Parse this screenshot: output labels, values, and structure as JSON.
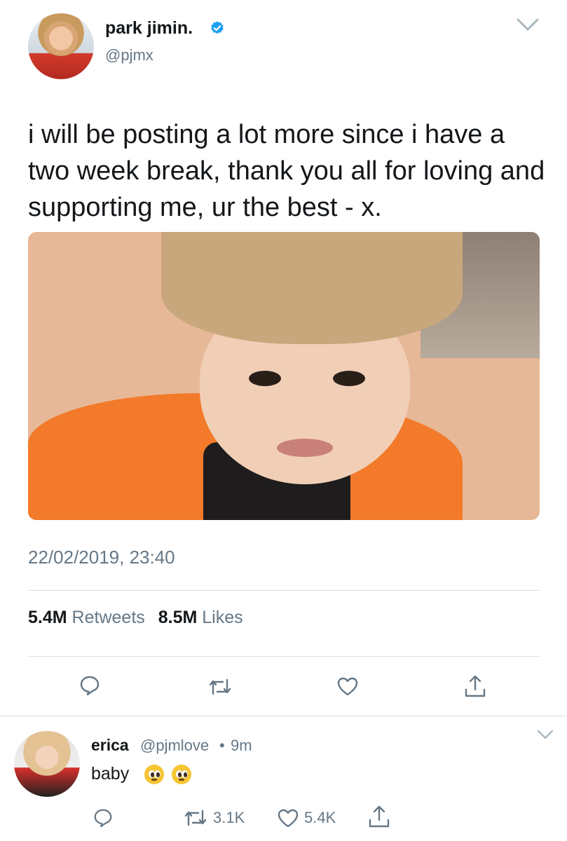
{
  "tweet": {
    "name": "park jimin.",
    "handle": "@pjmx",
    "text": "i will be posting a lot more since i have a two week break, thank you all for loving and supporting me, ur the best - x.",
    "timestamp": "22/02/2019, 23:40",
    "retweets_count": "5.4M",
    "retweets_label": "Retweets",
    "likes_count": "8.5M",
    "likes_label": "Likes"
  },
  "reply": {
    "name": "erica",
    "handle": "@pjmlove",
    "separator": "•",
    "time": "9m",
    "text": "baby",
    "retweet_count": "3.1K",
    "like_count": "5.4K"
  },
  "icons": {
    "verified": "verified-badge-icon",
    "caret": "chevron-down-icon",
    "reply": "reply-icon",
    "retweet": "retweet-icon",
    "like": "heart-icon",
    "share": "share-icon",
    "emoji": "pleading-face-emoji"
  },
  "colors": {
    "accent": "#1da1f2",
    "secondary_text": "#657786",
    "primary_text": "#14171a",
    "divider": "#d5dde3"
  }
}
